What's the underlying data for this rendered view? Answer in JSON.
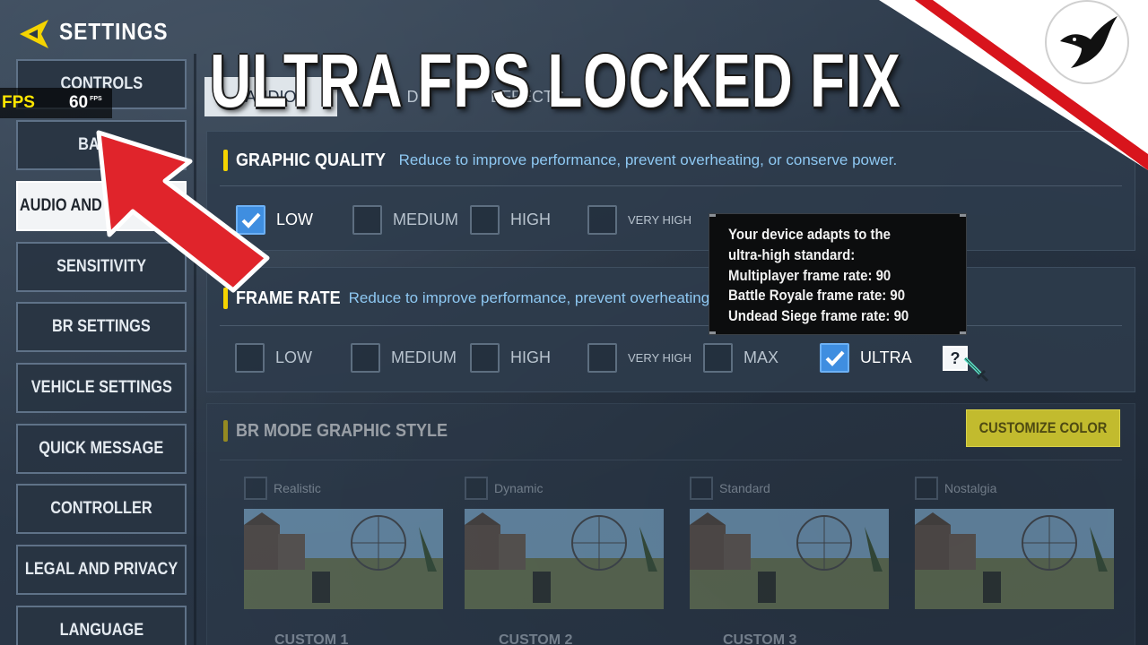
{
  "header": {
    "title": "SETTINGS",
    "back_icon": "back-arrow-icon",
    "accent_color": "#f5d400"
  },
  "fps_overlay": {
    "label": "FPS",
    "value": "60",
    "unit": "FPS"
  },
  "headline": "ULTRA FPS LOCKED FIX",
  "sidebar": {
    "items": [
      {
        "label": "CONTROLS",
        "active": false
      },
      {
        "label": "BASIC",
        "active": false
      },
      {
        "label": "AUDIO AND GRAPHICS",
        "active": true
      },
      {
        "label": "SENSITIVITY",
        "active": false
      },
      {
        "label": "BR SETTINGS",
        "active": false
      },
      {
        "label": "VEHICLE SETTINGS",
        "active": false
      },
      {
        "label": "QUICK MESSAGE",
        "active": false
      },
      {
        "label": "CONTROLLER",
        "active": false
      },
      {
        "label": "LEGAL AND PRIVACY",
        "active": false
      },
      {
        "label": "LANGUAGE",
        "active": false
      }
    ]
  },
  "tabs": [
    {
      "label": "AUDIO",
      "active": true
    },
    {
      "label": "D",
      "active": false
    },
    {
      "label": "EFFECTS",
      "active": false
    }
  ],
  "graphic_quality": {
    "title": "GRAPHIC QUALITY",
    "description": "Reduce to improve performance, prevent overheating, or conserve power.",
    "options": [
      {
        "label": "LOW",
        "checked": true
      },
      {
        "label": "MEDIUM",
        "checked": false
      },
      {
        "label": "HIGH",
        "checked": false
      },
      {
        "label": "VERY HIGH",
        "checked": false
      }
    ]
  },
  "frame_rate": {
    "title": "FRAME RATE",
    "description": "Reduce to improve performance, prevent overheating, or conserve power.",
    "options": [
      {
        "label": "LOW",
        "checked": false
      },
      {
        "label": "MEDIUM",
        "checked": false
      },
      {
        "label": "HIGH",
        "checked": false
      },
      {
        "label": "VERY HIGH",
        "checked": false
      },
      {
        "label": "MAX",
        "checked": false
      },
      {
        "label": "ULTRA",
        "checked": true
      }
    ],
    "help_label": "?"
  },
  "tooltip": {
    "lines": [
      "Your device adapts to the",
      "ultra-high standard:",
      "Multiplayer frame rate: 90",
      "Battle Royale frame rate: 90",
      "Undead Siege frame rate: 90"
    ]
  },
  "br_mode_style": {
    "title": "BR MODE GRAPHIC STYLE",
    "customize_label": "CUSTOMIZE COLOR",
    "styles": [
      {
        "name": "Realistic"
      },
      {
        "name": "Dynamic"
      },
      {
        "name": "Standard"
      },
      {
        "name": "Nostalgia"
      }
    ],
    "custom_labels": [
      "CUSTOM 1",
      "CUSTOM 2",
      "CUSTOM 3"
    ]
  },
  "colors": {
    "checked": "#3f8ee0",
    "description_text": "#8ec8f2",
    "annotation_arrow": "#e0242b",
    "customize_button": "#c2bb2e"
  }
}
